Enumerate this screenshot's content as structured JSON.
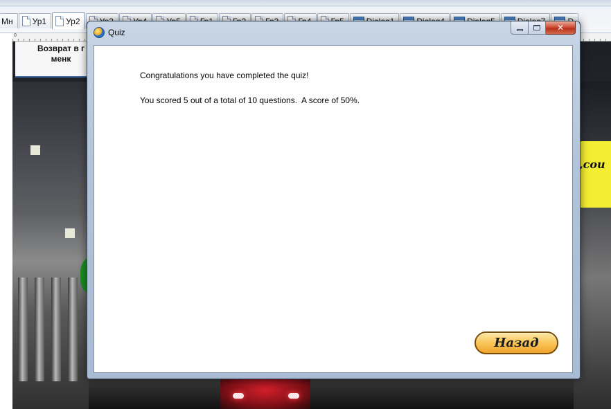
{
  "tabs": [
    {
      "label": "Мн",
      "icon": "none"
    },
    {
      "label": "Ур1",
      "icon": "page-icon"
    },
    {
      "label": "Ур2",
      "icon": "page-icon",
      "active": true
    },
    {
      "label": "Ур3",
      "icon": "page-icon"
    },
    {
      "label": "Ур4",
      "icon": "page-icon"
    },
    {
      "label": "Ур5",
      "icon": "page-icon"
    },
    {
      "label": "Гр1",
      "icon": "page-icon"
    },
    {
      "label": "Гр2",
      "icon": "page-icon"
    },
    {
      "label": "Гр3",
      "icon": "page-icon"
    },
    {
      "label": "Гр4",
      "icon": "page-icon"
    },
    {
      "label": "Гр5",
      "icon": "page-icon"
    },
    {
      "label": "Dialog1",
      "icon": "dialog-icon"
    },
    {
      "label": "Dialog4",
      "icon": "dialog-icon"
    },
    {
      "label": "Dialog5",
      "icon": "dialog-icon"
    },
    {
      "label": "Dialog7",
      "icon": "dialog-icon"
    },
    {
      "label": "D",
      "icon": "dialog-icon"
    }
  ],
  "ruler": {
    "start": "0"
  },
  "background": {
    "menu_button": {
      "line1": "Возврат в г",
      "line2": "менк"
    },
    "side_text": ",cou"
  },
  "dialog": {
    "title": "Quiz",
    "app_icon": "globe-icon",
    "message_line1": "Congratulations you have completed the quiz!",
    "message_line2": "You scored 5 out of a total of 10 questions.  A score of 50%.",
    "back_button": "Назад",
    "caption": {
      "minimize_icon": "minimize-icon",
      "maximize_icon": "maximize-icon",
      "close_icon": "close-icon",
      "close_glyph": "✕"
    }
  },
  "colors": {
    "button_gradient_top": "#fde7a5",
    "button_gradient_bottom": "#f0a42a",
    "close_red": "#c23a22",
    "frame_blue": "#b2c4d9"
  }
}
